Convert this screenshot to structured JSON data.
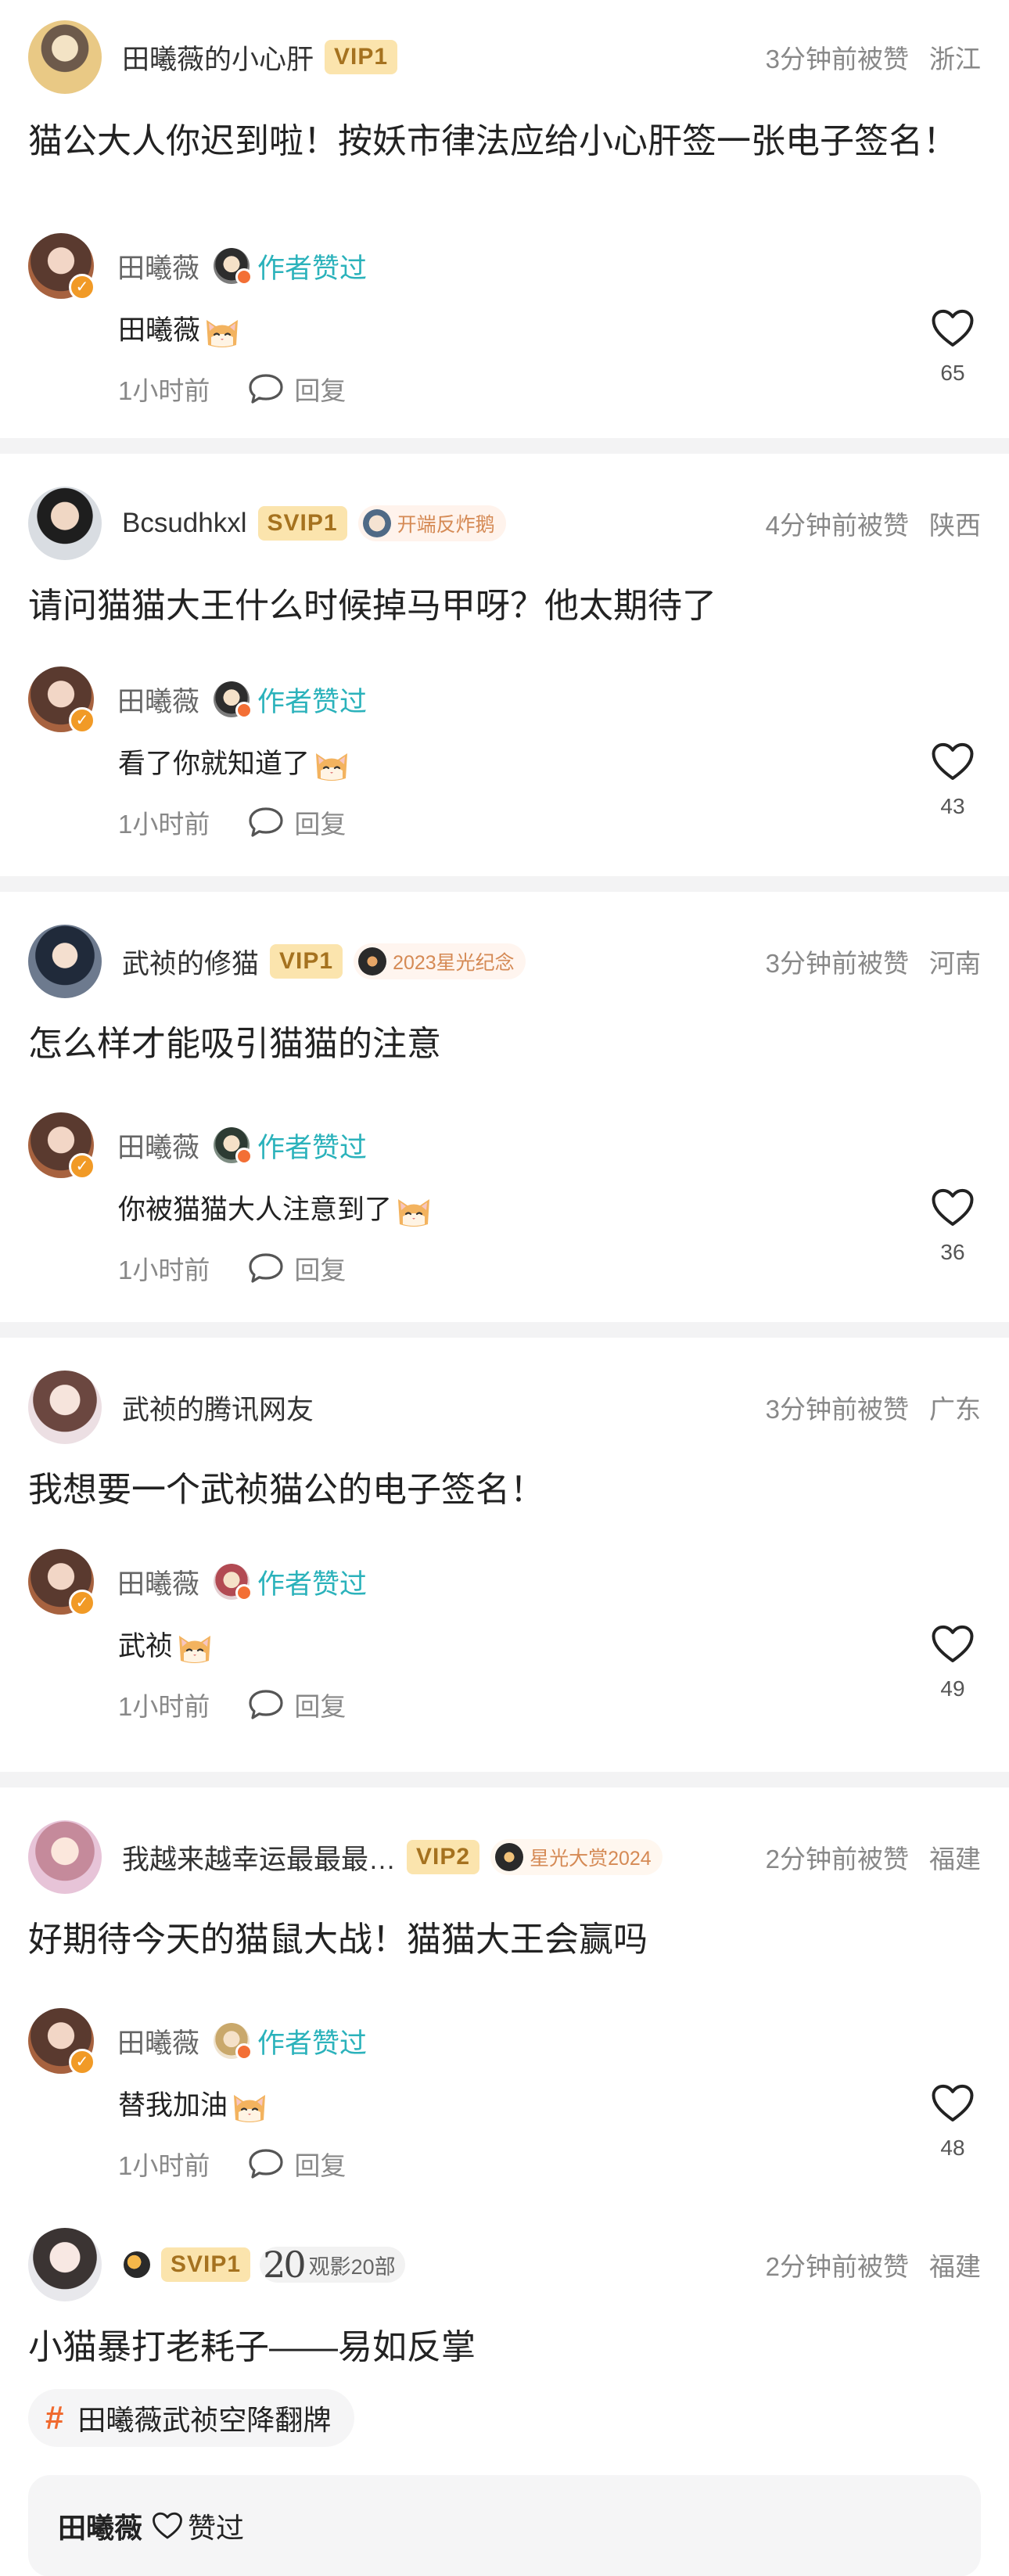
{
  "ui": {
    "author_liked": "作者赞过",
    "reply": "回复",
    "cat_emoji_name": "cat-face-emoji",
    "accent": "#2bb2bb",
    "vip_bg": "#fbe4ad"
  },
  "comments": [
    {
      "user": "田曦薇的小心肝",
      "vip": "VIP1",
      "time": "3分钟前被赞",
      "location": "浙江",
      "text": "猫公大人你迟到啦！按妖市律法应给小心肝签一张电子签名！",
      "reply": {
        "name": "田曦薇",
        "text": "田曦薇",
        "time": "1小时前",
        "likes": "65"
      }
    },
    {
      "user": "Bcsudhkxl",
      "vip": "SVIP1",
      "badge": "开端反炸鹅",
      "time": "4分钟前被赞",
      "location": "陕西",
      "text": "请问猫猫大王什么时候掉马甲呀？他太期待了",
      "reply": {
        "name": "田曦薇",
        "text": "看了你就知道了",
        "time": "1小时前",
        "likes": "43"
      }
    },
    {
      "user": "武祯的修猫",
      "vip": "VIP1",
      "badge": "2023星光纪念",
      "time": "3分钟前被赞",
      "location": "河南",
      "text": "怎么样才能吸引猫猫的注意",
      "reply": {
        "name": "田曦薇",
        "text": "你被猫猫大人注意到了",
        "time": "1小时前",
        "likes": "36"
      }
    },
    {
      "user": "武祯的腾讯网友",
      "time": "3分钟前被赞",
      "location": "广东",
      "text": "我想要一个武祯猫公的电子签名！",
      "reply": {
        "name": "田曦薇",
        "text": "武祯",
        "time": "1小时前",
        "likes": "49"
      }
    },
    {
      "user": "我越来越幸运最最最…",
      "vip": "VIP2",
      "badge": "星光大赏2024",
      "time": "2分钟前被赞",
      "location": "福建",
      "text": "好期待今天的猫鼠大战！猫猫大王会赢吗",
      "reply": {
        "name": "田曦薇",
        "text": "替我加油",
        "time": "1小时前",
        "likes": "48"
      }
    },
    {
      "user": "",
      "vip": "SVIP1",
      "views_num": "20",
      "views_label": "观影20部",
      "time": "2分钟前被赞",
      "location": "福建",
      "text": "小猫暴打老耗子——易如反掌",
      "topic": "田曦薇武祯空降翻牌",
      "liked_by": "田曦薇",
      "liked_label": "赞过"
    }
  ]
}
